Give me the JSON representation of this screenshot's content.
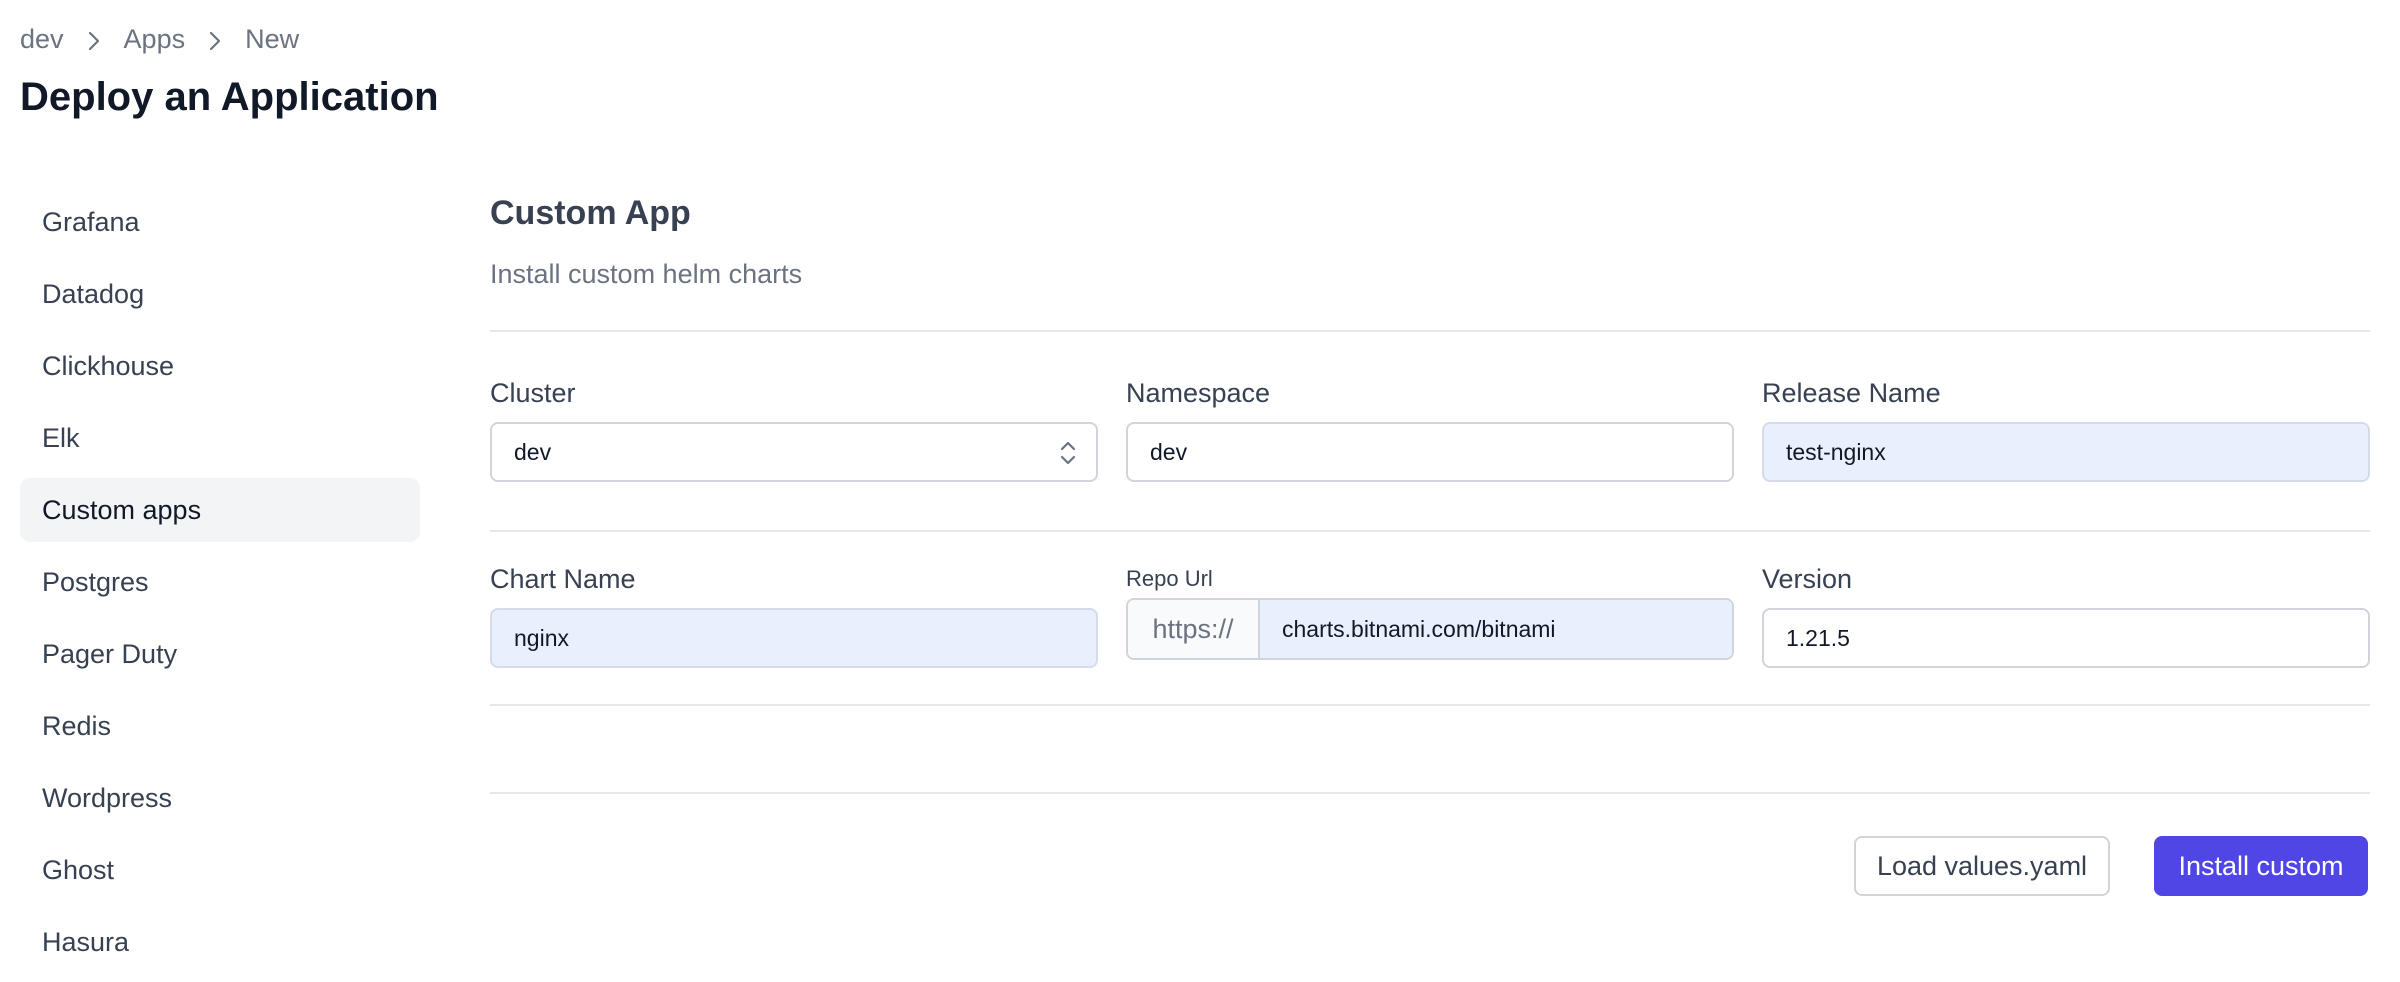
{
  "breadcrumb": {
    "items": [
      "dev",
      "Apps",
      "New"
    ]
  },
  "page": {
    "title": "Deploy an Application"
  },
  "sidebar": {
    "active_index": 4,
    "items": [
      {
        "label": "Grafana"
      },
      {
        "label": "Datadog"
      },
      {
        "label": "Clickhouse"
      },
      {
        "label": "Elk"
      },
      {
        "label": "Custom apps"
      },
      {
        "label": "Postgres"
      },
      {
        "label": "Pager Duty"
      },
      {
        "label": "Redis"
      },
      {
        "label": "Wordpress"
      },
      {
        "label": "Ghost"
      },
      {
        "label": "Hasura"
      }
    ]
  },
  "main": {
    "title": "Custom App",
    "subtitle": "Install custom helm charts",
    "form": {
      "cluster": {
        "label": "Cluster",
        "value": "dev"
      },
      "namespace": {
        "label": "Namespace",
        "value": "dev"
      },
      "release_name": {
        "label": "Release Name",
        "value": "test-nginx"
      },
      "chart_name": {
        "label": "Chart Name",
        "value": "nginx"
      },
      "repo_url": {
        "label": "Repo Url",
        "prefix": "https://",
        "value": "charts.bitnami.com/bitnami"
      },
      "version": {
        "label": "Version",
        "value": "1.21.5"
      }
    },
    "actions": {
      "load_values": "Load values.yaml",
      "install": "Install custom"
    }
  },
  "colors": {
    "primary": "#4f46e5",
    "autofill_bg": "#e8f0fe",
    "active_nav_bg": "#f3f4f6"
  },
  "icons": {
    "breadcrumb_separator": "chevron-right-icon",
    "select_arrow": "chevron-up-down-icon"
  }
}
